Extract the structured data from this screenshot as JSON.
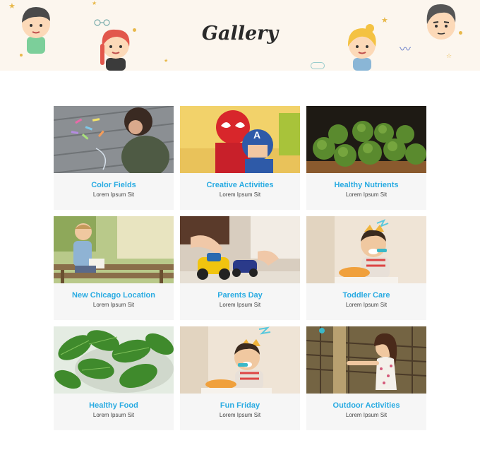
{
  "header": {
    "title": "Gallery"
  },
  "colors": {
    "accent": "#29abe2",
    "banner_bg": "#fcf6ee",
    "card_bg": "#f6f6f6"
  },
  "gallery": {
    "items": [
      {
        "title": "Color Fields",
        "subtitle": "Lorem Ipsum Sit",
        "photo": "child-with-sidewalk-chalk-photo"
      },
      {
        "title": "Creative Activities",
        "subtitle": "Lorem Ipsum Sit",
        "photo": "kids-in-superhero-masks-photo"
      },
      {
        "title": "Healthy Nutrients",
        "subtitle": "Lorem Ipsum Sit",
        "photo": "brussels-sprouts-photo"
      },
      {
        "title": "New Chicago Location",
        "subtitle": "Lorem Ipsum Sit",
        "photo": "boy-on-park-bench-photo"
      },
      {
        "title": "Parents Day",
        "subtitle": "Lorem Ipsum Sit",
        "photo": "toy-cars-photo"
      },
      {
        "title": "Toddler Care",
        "subtitle": "Lorem Ipsum Sit",
        "photo": "toddler-eating-photo"
      },
      {
        "title": "Healthy Food",
        "subtitle": "Lorem Ipsum Sit",
        "photo": "spinach-leaves-photo"
      },
      {
        "title": "Fun Friday",
        "subtitle": "Lorem Ipsum Sit",
        "photo": "toddler-eating-photo"
      },
      {
        "title": "Outdoor Activities",
        "subtitle": "Lorem Ipsum Sit",
        "photo": "girl-on-playground-photo"
      }
    ]
  }
}
